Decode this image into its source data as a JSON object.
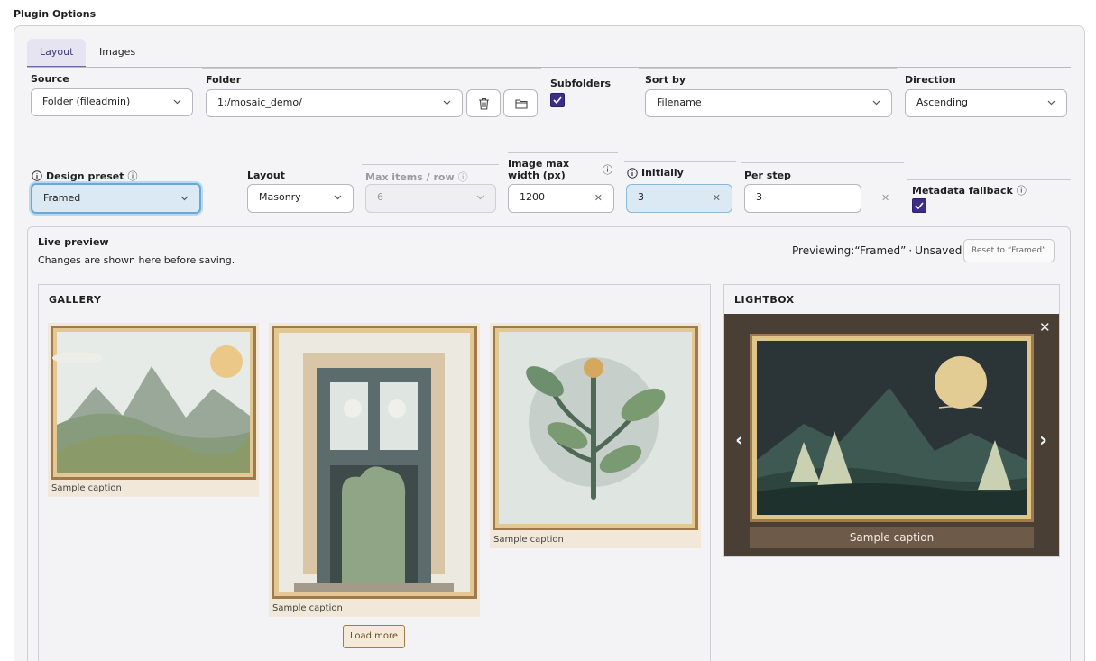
{
  "page": {
    "title": "Plugin Options"
  },
  "tabs": [
    {
      "label": "Layout",
      "active": true
    },
    {
      "label": "Images",
      "active": false
    }
  ],
  "row1": {
    "source": {
      "label": "Source",
      "value": "Folder (fileadmin)"
    },
    "folder": {
      "label": "Folder",
      "value": "1:/mosaic_demo/"
    },
    "subfolders": {
      "label": "Subfolders",
      "checked": true
    },
    "sort_by": {
      "label": "Sort by",
      "value": "Filename"
    },
    "direction": {
      "label": "Direction",
      "value": "Ascending"
    }
  },
  "row2": {
    "design_preset": {
      "label": "Design preset",
      "value": "Framed"
    },
    "layout": {
      "label": "Layout",
      "value": "Masonry"
    },
    "max_items": {
      "label": "Max items / row",
      "value": "6"
    },
    "image_max_width": {
      "label_line1": "Image max",
      "label_line2": "width (px)",
      "value": "1200"
    },
    "initially": {
      "label": "Initially",
      "value": "3"
    },
    "per_step": {
      "label": "Per step",
      "value": "3"
    },
    "metadata_fallback": {
      "label": "Metadata fallback",
      "checked": true
    }
  },
  "preview": {
    "title": "Live preview",
    "subtitle": "Changes are shown here before saving.",
    "status_prefix": "Previewing:",
    "status_preset": "“Framed”",
    "status_sep": "·",
    "status_unsaved": "Unsaved",
    "reset_label": "Reset to “Framed”"
  },
  "gallery": {
    "heading": "GALLERY",
    "items": [
      {
        "caption": "Sample caption"
      },
      {
        "caption": "Sample caption"
      },
      {
        "caption": "Sample caption"
      }
    ],
    "load_more": "Load more"
  },
  "lightbox": {
    "heading": "LIGHTBOX",
    "caption": "Sample caption",
    "close_glyph": "✕",
    "prev_glyph": "‹",
    "next_glyph": "›"
  },
  "icons": {
    "chevron": "chevron-down-icon",
    "trash": "trash-icon",
    "folder": "folder-icon",
    "info": "info-icon",
    "clear": "clear-icon"
  },
  "colors": {
    "accent": "#3d2d8a",
    "frame": "#9a7140",
    "focus": "#6aa9d3"
  }
}
